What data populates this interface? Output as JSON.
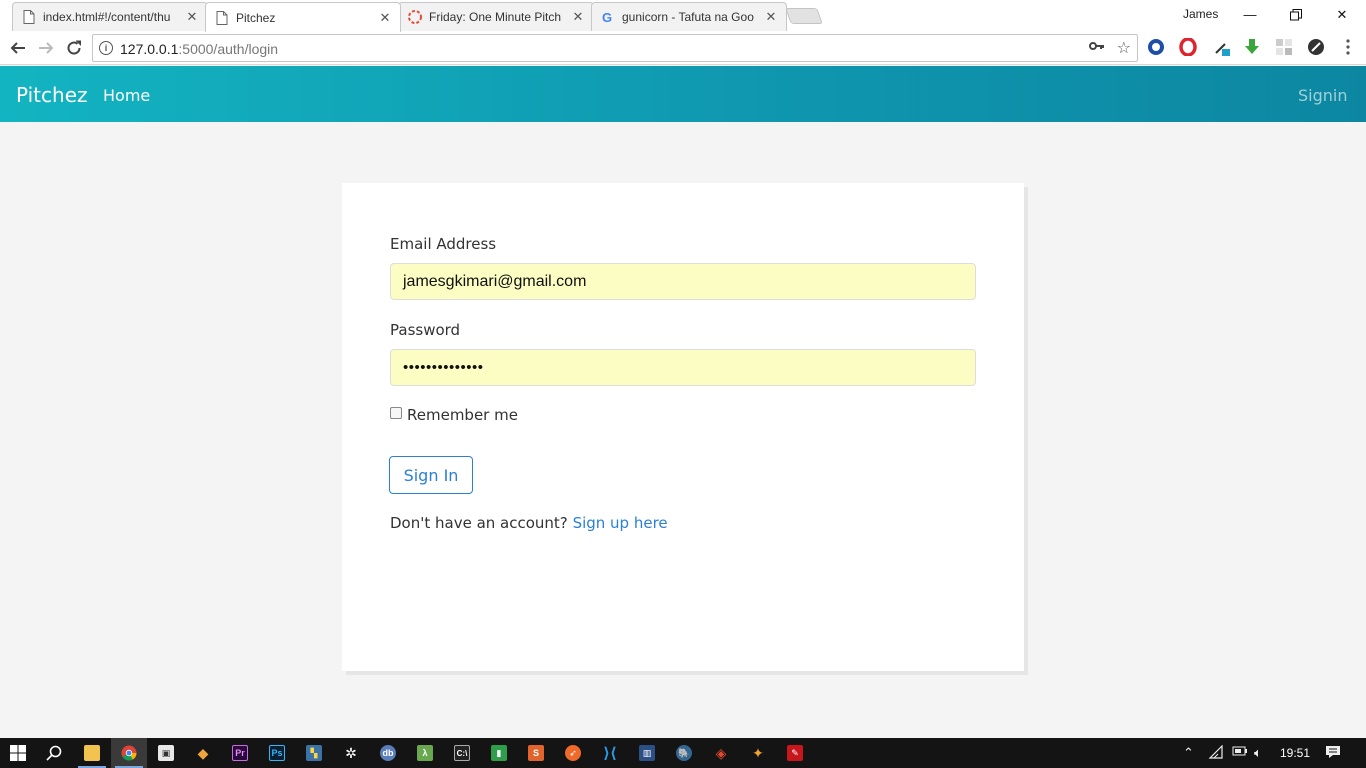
{
  "tabs": [
    {
      "title": "index.html#!/content/thu",
      "favicon": "document-icon",
      "active": false
    },
    {
      "title": "Pitchez",
      "favicon": "document-icon",
      "active": true
    },
    {
      "title": "Friday: One Minute Pitch",
      "favicon": "loading-spinner-icon",
      "active": false
    },
    {
      "title": "gunicorn - Tafuta na Goo",
      "favicon": "google-icon",
      "active": false
    }
  ],
  "profile_name": "James",
  "address_bar": {
    "host": "127.0.0.1",
    "path": ":5000/auth/login"
  },
  "app": {
    "brand": "Pitchez",
    "nav_home": "Home",
    "nav_signin": "Signin"
  },
  "login_form": {
    "email_label": "Email Address",
    "email_value": "jamesgkimari@gmail.com",
    "password_label": "Password",
    "password_value": "••••••••••••••",
    "remember_label": "Remember me",
    "remember_checked": false,
    "submit_label": "Sign In",
    "signup_prompt": "Don't have an account?",
    "signup_link": "Sign up here"
  },
  "taskbar": {
    "clock": "19:51"
  },
  "colors": {
    "navbar_gradient_start": "#13b4c1",
    "navbar_gradient_end": "#0d87a1",
    "accent_blue": "#2b7fd6",
    "autofill_yellow": "#fbfdc3"
  }
}
